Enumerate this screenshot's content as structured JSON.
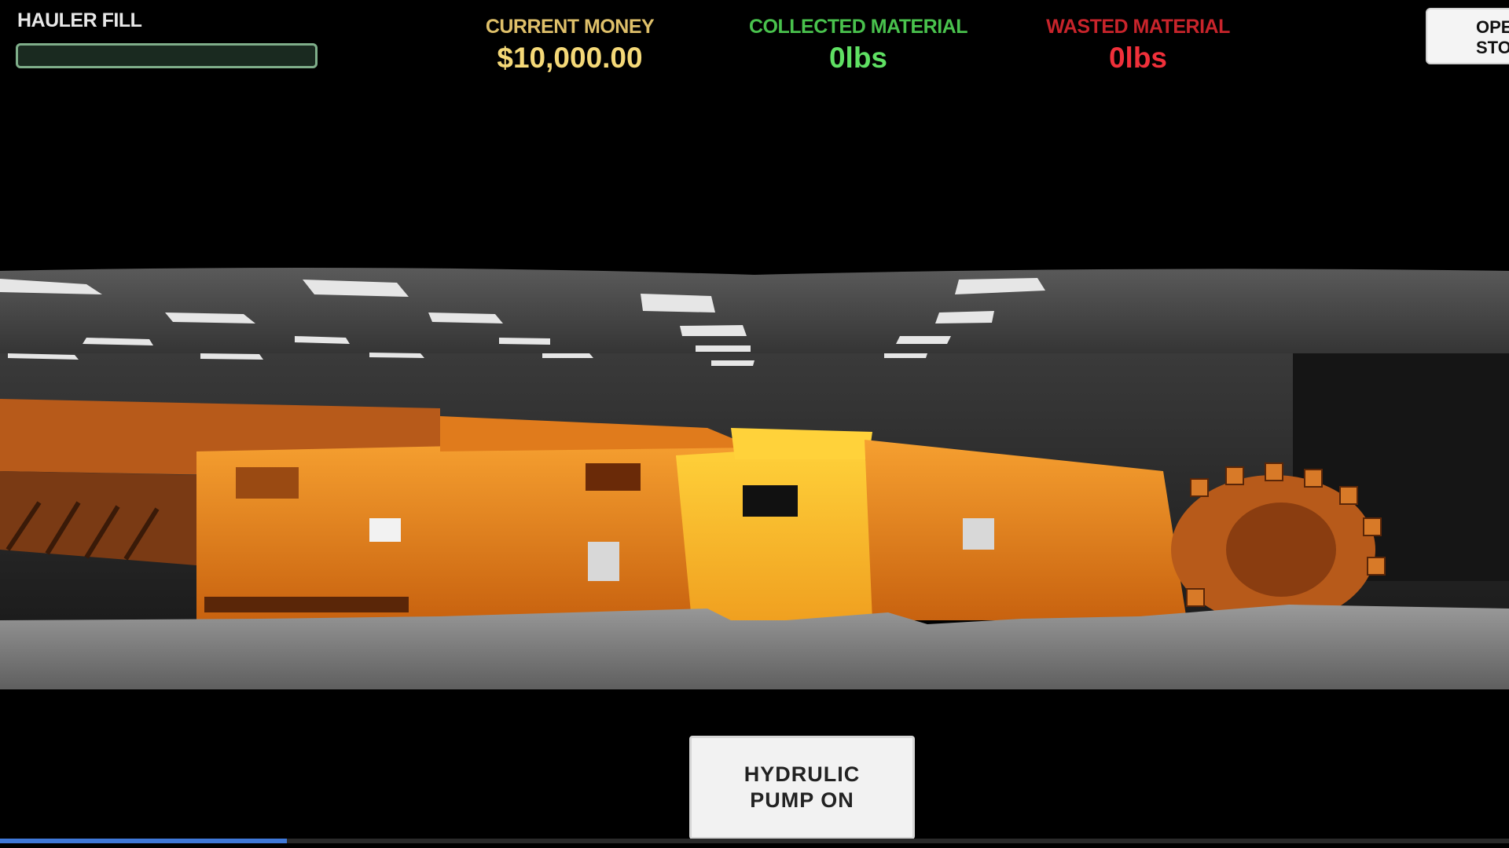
{
  "hud": {
    "hauler_fill_label": "HAULER FILL",
    "hauler_fill_fraction": 0.0,
    "current_money_label": "CURRENT MONEY",
    "current_money_value": "$10,000.00",
    "collected_label": "COLLECTED MATERIAL",
    "collected_value": "0lbs",
    "wasted_label": "WASTED MATERIAL",
    "wasted_value": "0lbs",
    "store_button_label": "OPE\nSTO"
  },
  "controls": {
    "pump_button_label": "HYDRULIC\nPUMP ON"
  },
  "video": {
    "progress_fraction": 0.19
  },
  "colors": {
    "money": "#f5d978",
    "collected": "#5fe063",
    "wasted": "#f0303a",
    "machine_orange": "#e8861c"
  }
}
